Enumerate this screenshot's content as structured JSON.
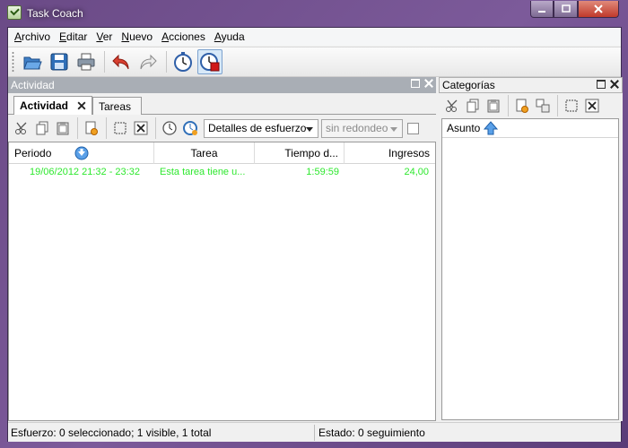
{
  "window": {
    "title": "Task Coach"
  },
  "menu": [
    "Archivo",
    "Editar",
    "Ver",
    "Nuevo",
    "Acciones",
    "Ayuda"
  ],
  "left_panel": {
    "title": "Actividad",
    "tabs": [
      {
        "label": "Actividad",
        "active": true
      },
      {
        "label": "Tareas",
        "active": false
      }
    ],
    "effort_detail_select": "Detalles de esfuerzo",
    "rounding_select": "sin redondeo",
    "columns": [
      "Periodo",
      "Tarea",
      "Tiempo d...",
      "Ingresos"
    ],
    "rows": [
      {
        "period": "19/06/2012 21:32 - 23:32",
        "task": "Esta tarea tiene u...",
        "time": "1:59:59",
        "income": "24,00"
      }
    ],
    "row_color": "#2ee82e"
  },
  "right_panel": {
    "title": "Categorías",
    "column": "Asunto"
  },
  "status": {
    "left": "Esfuerzo: 0 seleccionado; 1 visible, 1 total",
    "right": "Estado: 0 seguimiento"
  }
}
